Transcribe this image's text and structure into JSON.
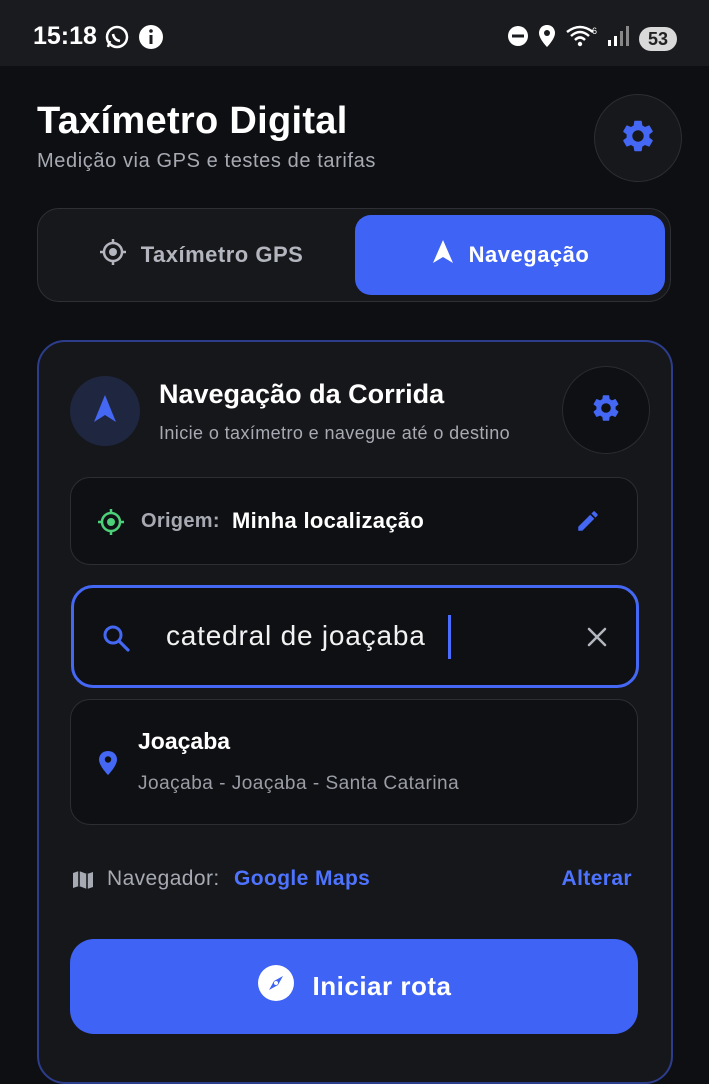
{
  "status_bar": {
    "time": "15:18",
    "battery": "53",
    "icons_left": [
      "whatsapp-icon",
      "info-icon"
    ],
    "icons_right": [
      "dnd-icon",
      "location-icon",
      "wifi-6-icon",
      "signal-icon",
      "battery-icon"
    ]
  },
  "header": {
    "title": "Taxímetro Digital",
    "subtitle": "Medição via GPS e testes de tarifas"
  },
  "tabs": [
    {
      "label": "Taxímetro GPS",
      "active": false,
      "icon": "gps-target-icon"
    },
    {
      "label": "Navegação",
      "active": true,
      "icon": "navigation-arrow-icon"
    }
  ],
  "navigation_card": {
    "title": "Navegação da Corrida",
    "subtitle": "Inicie o taxímetro e navegue até o destino",
    "origin": {
      "label": "Origem:",
      "value": "Minha localização"
    },
    "search": {
      "value": "catedral de joaçaba",
      "placeholder": ""
    },
    "results": [
      {
        "title": "Joaçaba",
        "subtitle": "Joaçaba - Joaçaba - Santa Catarina"
      }
    ],
    "navigator": {
      "label": "Navegador:",
      "value": "Google Maps",
      "change_label": "Alterar"
    },
    "start_button": "Iniciar rota"
  },
  "colors": {
    "accent": "#3e63f5",
    "background": "#0e0f12",
    "card": "#16171b",
    "origin_green": "#4cd07a"
  }
}
